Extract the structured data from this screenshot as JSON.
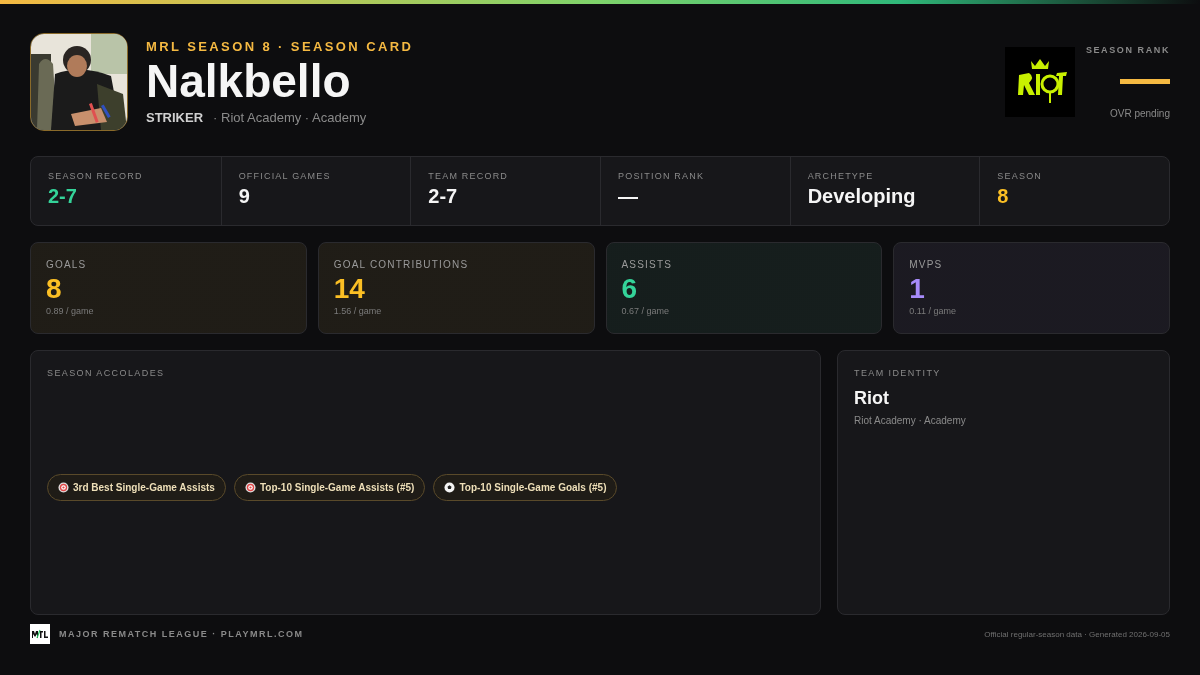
{
  "header": {
    "eyebrow": "MRL SEASON 8 · SEASON CARD",
    "player_name": "Nalkbello",
    "position": "STRIKER",
    "team_line": "· Riot Academy · Academy"
  },
  "rank": {
    "label": "SEASON RANK",
    "pending": "OVR pending"
  },
  "summary": [
    {
      "label": "SEASON RECORD",
      "value": "2-7",
      "color": "#34d399"
    },
    {
      "label": "OFFICIAL GAMES",
      "value": "9",
      "color": "#f5f5f5"
    },
    {
      "label": "TEAM RECORD",
      "value": "2-7",
      "color": "#f5f5f5"
    },
    {
      "label": "POSITION RANK",
      "value": "—",
      "color": "#f5f5f5"
    },
    {
      "label": "ARCHETYPE",
      "value": "Developing",
      "color": "#f5f5f5"
    },
    {
      "label": "SEASON",
      "value": "8",
      "color": "#fbbf24"
    }
  ],
  "stat_cards": [
    {
      "label": "GOALS",
      "value": "8",
      "per_game": "0.89 / game",
      "color": "#fbbf24"
    },
    {
      "label": "GOAL CONTRIBUTIONS",
      "value": "14",
      "per_game": "1.56 / game",
      "color": "#fbbf24"
    },
    {
      "label": "ASSISTS",
      "value": "6",
      "per_game": "0.67 / game",
      "color": "#34d399"
    },
    {
      "label": "MVPS",
      "value": "1",
      "per_game": "0.11 / game",
      "color": "#a78bfa"
    }
  ],
  "accolades": {
    "title": "SEASON ACCOLADES",
    "items": [
      {
        "kind": "target",
        "label": "3rd Best Single-Game Assists"
      },
      {
        "kind": "target",
        "label": "Top-10 Single-Game Assists (#5)"
      },
      {
        "kind": "ball",
        "label": "Top-10 Single-Game Goals (#5)"
      }
    ]
  },
  "team_identity": {
    "title": "TEAM IDENTITY",
    "team": "Riot",
    "subtitle": "Riot Academy · Academy"
  },
  "footer": {
    "brand": "MAJOR REMATCH LEAGUE · PLAYMRL.COM",
    "note": "Official regular-season data · Generated 2026-09-05"
  }
}
